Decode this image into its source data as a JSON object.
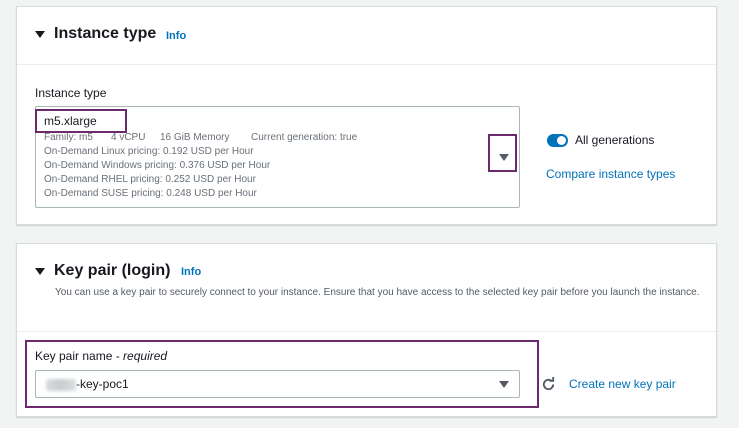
{
  "instance_type": {
    "title": "Instance type",
    "info": "Info",
    "field_label": "Instance type",
    "selected": "m5.xlarge",
    "details": {
      "family": "Family: m5",
      "vcpu": "4 vCPU",
      "memory": "16 GiB Memory",
      "generation": "Current generation: true",
      "linux": "On-Demand Linux pricing: 0.192 USD per Hour",
      "windows": "On-Demand Windows pricing: 0.376 USD per Hour",
      "rhel": "On-Demand RHEL pricing: 0.252 USD per Hour",
      "suse": "On-Demand SUSE pricing: 0.248 USD per Hour"
    },
    "toggle_label": "All generations",
    "toggle_on": true,
    "compare_link": "Compare instance types"
  },
  "key_pair": {
    "title": "Key pair (login)",
    "info": "Info",
    "description": "You can use a key pair to securely connect to your instance. Ensure that you have access to the selected key pair before you launch the instance.",
    "field_label": "Key pair name - ",
    "field_label_required": "required",
    "selected_suffix": "-key-poc1",
    "create_link": "Create new key pair"
  },
  "colors": {
    "accent": "#0073bb",
    "highlight": "#6b2a6b"
  }
}
